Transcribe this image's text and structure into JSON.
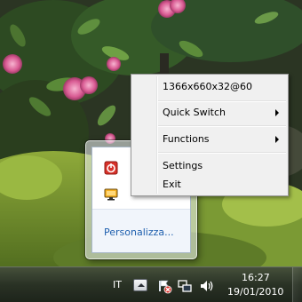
{
  "context_menu": {
    "resolution_label": "1366x660x32@60",
    "quick_switch_label": "Quick Switch",
    "functions_label": "Functions",
    "settings_label": "Settings",
    "exit_label": "Exit"
  },
  "tray_overflow": {
    "customize_link": "Personalizza..."
  },
  "taskbar": {
    "language": "IT",
    "time": "16:27",
    "date": "19/01/2010",
    "tray_icons": [
      "network-error-icon",
      "action-center-icon",
      "volume-icon"
    ]
  },
  "icons": {
    "overflow": [
      "power-app-icon",
      "monitor-app-icon"
    ]
  }
}
